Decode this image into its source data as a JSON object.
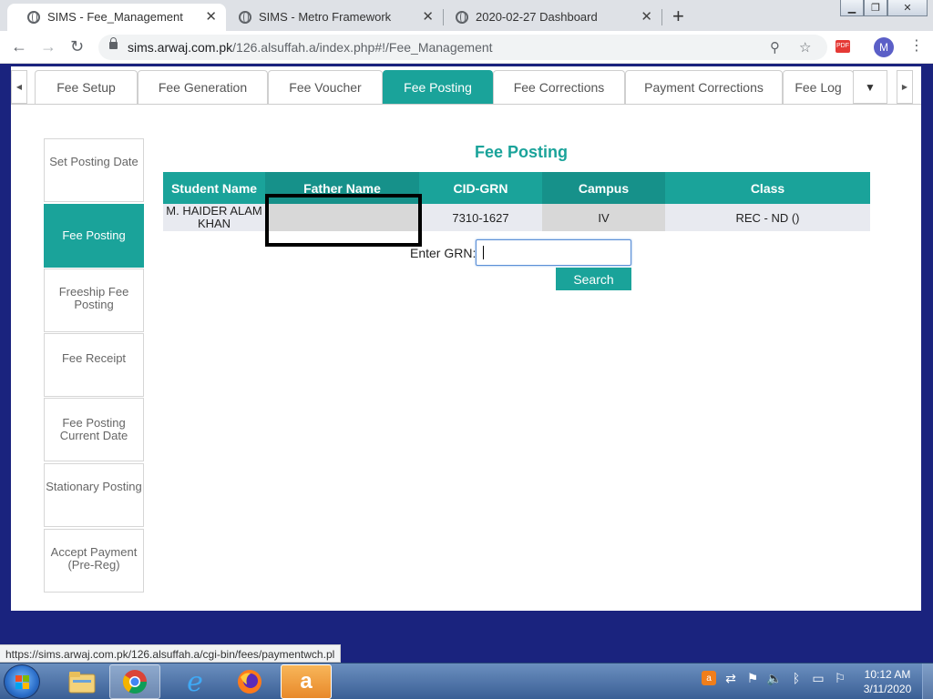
{
  "browser": {
    "tabs": [
      {
        "title": "SIMS - Fee_Management",
        "active": true
      },
      {
        "title": "SIMS - Metro Framework",
        "active": false
      },
      {
        "title": "2020-02-27 Dashboard",
        "active": false
      }
    ],
    "new_tab": "+",
    "url_host": "sims.arwaj.com.pk",
    "url_path": "/126.alsuffah.a/index.php#!/Fee_Management",
    "profile_initial": "M",
    "extension_label": "PDF"
  },
  "app_tabs": [
    "Fee Setup",
    "Fee Generation",
    "Fee Voucher",
    "Fee Posting",
    "Fee Corrections",
    "Payment Corrections",
    "Fee Log"
  ],
  "app_tabs_active": "Fee Posting",
  "left_menu": [
    {
      "label": "Set Posting Date",
      "active": false
    },
    {
      "label": "Fee Posting",
      "active": true
    },
    {
      "label": "Freeship Fee Posting",
      "active": false
    },
    {
      "label": "Fee Receipt",
      "active": false
    },
    {
      "label": "Fee Posting Current Date",
      "active": false
    },
    {
      "label": "Stationary Posting",
      "active": false
    },
    {
      "label": "Accept Payment (Pre-Reg)",
      "active": false
    }
  ],
  "main": {
    "title": "Fee Posting",
    "columns": [
      "Student Name",
      "Father Name",
      "CID-GRN",
      "Campus",
      "Class"
    ],
    "row": {
      "student_name": "M. HAIDER ALAM KHAN",
      "father_name": "",
      "cid_grn": "7310-1627",
      "campus": "IV",
      "class": "REC - ND ()"
    },
    "grn_label": "Enter GRN:",
    "grn_value": "",
    "search_label": "Search"
  },
  "status_url": "https://sims.arwaj.com.pk/126.alsuffah.a/cgi-bin/fees/paymentwch.pl",
  "taskbar": {
    "time": "10:12 AM",
    "date": "3/11/2020"
  },
  "colors": {
    "accent": "#1aa39a",
    "accent_dark": "#16918a",
    "page_bg": "#1a237e"
  }
}
